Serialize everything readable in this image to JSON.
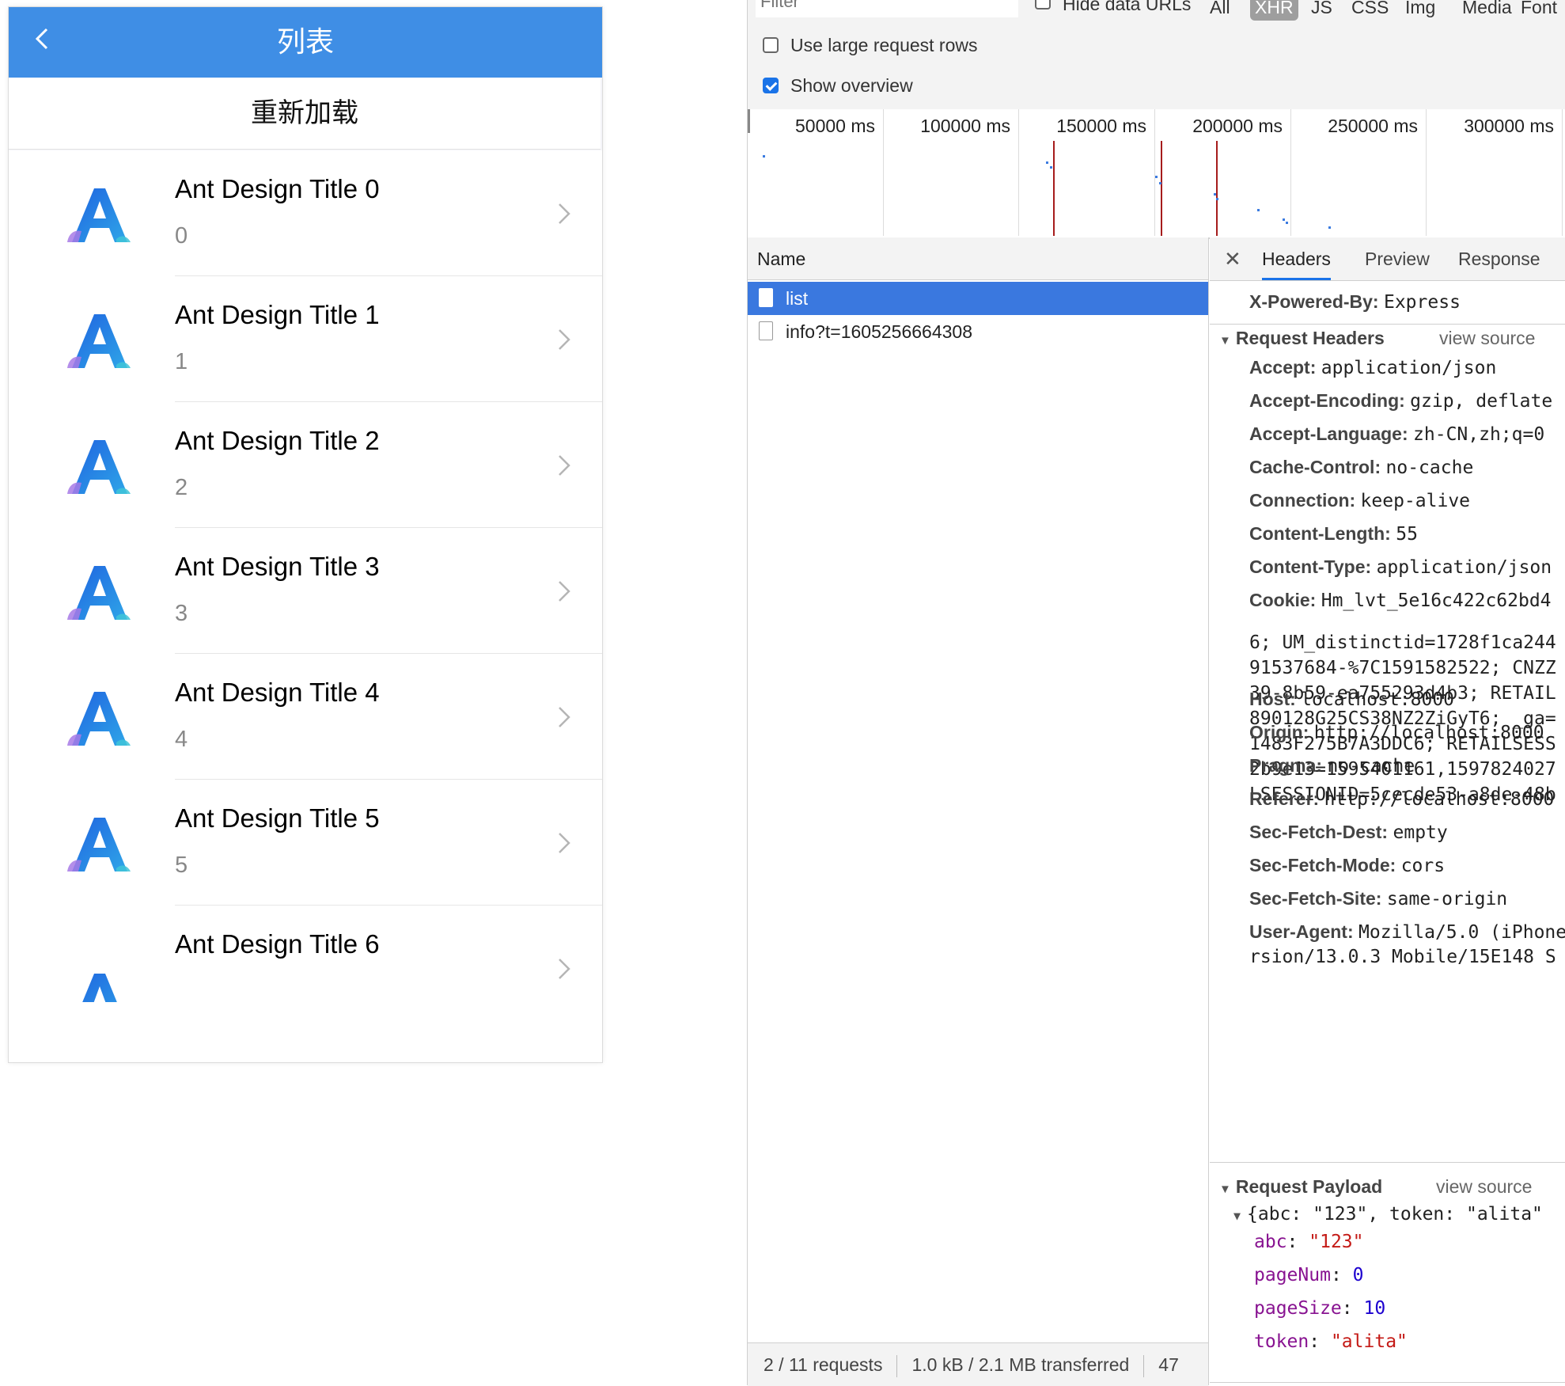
{
  "app": {
    "nav_title": "列表",
    "reload_label": "重新加载",
    "items": [
      {
        "title": "Ant Design Title 0",
        "subtitle": "0"
      },
      {
        "title": "Ant Design Title 1",
        "subtitle": "1"
      },
      {
        "title": "Ant Design Title 2",
        "subtitle": "2"
      },
      {
        "title": "Ant Design Title 3",
        "subtitle": "3"
      },
      {
        "title": "Ant Design Title 4",
        "subtitle": "4"
      },
      {
        "title": "Ant Design Title 5",
        "subtitle": "5"
      },
      {
        "title": "Ant Design Title 6",
        "subtitle": ""
      }
    ],
    "accent_color": "#3f8ee5"
  },
  "devtools": {
    "filter_placeholder": "Filter",
    "hide_data_urls_label": "Hide data URLs",
    "hide_data_urls_checked": false,
    "type_filters": [
      "All",
      "XHR",
      "JS",
      "CSS",
      "Img",
      "Media",
      "Font"
    ],
    "active_type": "XHR",
    "large_rows_label": "Use large request rows",
    "large_rows_checked": false,
    "show_overview_label": "Show overview",
    "show_overview_checked": true,
    "timeline_ticks": [
      "50000 ms",
      "100000 ms",
      "150000 ms",
      "200000 ms",
      "250000 ms",
      "300000 ms"
    ],
    "name_column": "Name",
    "requests": [
      {
        "name": "list",
        "selected": true
      },
      {
        "name": "info?t=1605256664308",
        "selected": false
      }
    ],
    "status": {
      "requests": "2 / 11 requests",
      "transferred": "1.0 kB / 2.1 MB transferred",
      "extra": "47"
    },
    "detail_tabs": [
      "Headers",
      "Preview",
      "Response"
    ],
    "active_detail_tab": "Headers",
    "x_powered_by": {
      "name": "X-Powered-By:",
      "value": "Express"
    },
    "request_headers_title": "Request Headers",
    "view_source_label": "view source",
    "request_headers": [
      {
        "name": "Accept:",
        "value": "application/json"
      },
      {
        "name": "Accept-Encoding:",
        "value": "gzip, deflate"
      },
      {
        "name": "Accept-Language:",
        "value": "zh-CN,zh;q=0"
      },
      {
        "name": "Cache-Control:",
        "value": "no-cache"
      },
      {
        "name": "Connection:",
        "value": "keep-alive"
      },
      {
        "name": "Content-Length:",
        "value": "55"
      },
      {
        "name": "Content-Type:",
        "value": "application/json"
      },
      {
        "name": "Cookie:",
        "value": "Hm_lvt_5e16c422c62bd4"
      }
    ],
    "cookie_continuation": [
      "6; UM_distinctid=1728f1ca244",
      "91537684-%7C1591582522; CNZZ",
      "39-8b59-ea755293d4b3; RETAIL",
      "890128G25CS38NZ2ZiGyT6; _ga=",
      "1483F275B7A3DDC6; RETAILSESS",
      "2b9e13=1595401161,1597824027",
      "LSESSIONID=5cecde53-a8de-48b"
    ],
    "request_headers_2": [
      {
        "name": "Host:",
        "value": "localhost:8000"
      },
      {
        "name": "Origin:",
        "value": "http://localhost:8000"
      },
      {
        "name": "Pragma:",
        "value": "no-cache"
      },
      {
        "name": "Referer:",
        "value": "http://localhost:8000"
      },
      {
        "name": "Sec-Fetch-Dest:",
        "value": "empty"
      },
      {
        "name": "Sec-Fetch-Mode:",
        "value": "cors"
      },
      {
        "name": "Sec-Fetch-Site:",
        "value": "same-origin"
      },
      {
        "name": "User-Agent:",
        "value": "Mozilla/5.0 (iPhone"
      }
    ],
    "user_agent_continuation": "rsion/13.0.3 Mobile/15E148 S",
    "request_payload_title": "Request Payload",
    "payload_summary": "{abc: \"123\", token: \"alita\"",
    "payload_fields": [
      {
        "key": "abc",
        "value": "\"123\"",
        "kind": "string"
      },
      {
        "key": "pageNum",
        "value": "0",
        "kind": "number"
      },
      {
        "key": "pageSize",
        "value": "10",
        "kind": "number"
      },
      {
        "key": "token",
        "value": "\"alita\"",
        "kind": "string"
      }
    ]
  }
}
